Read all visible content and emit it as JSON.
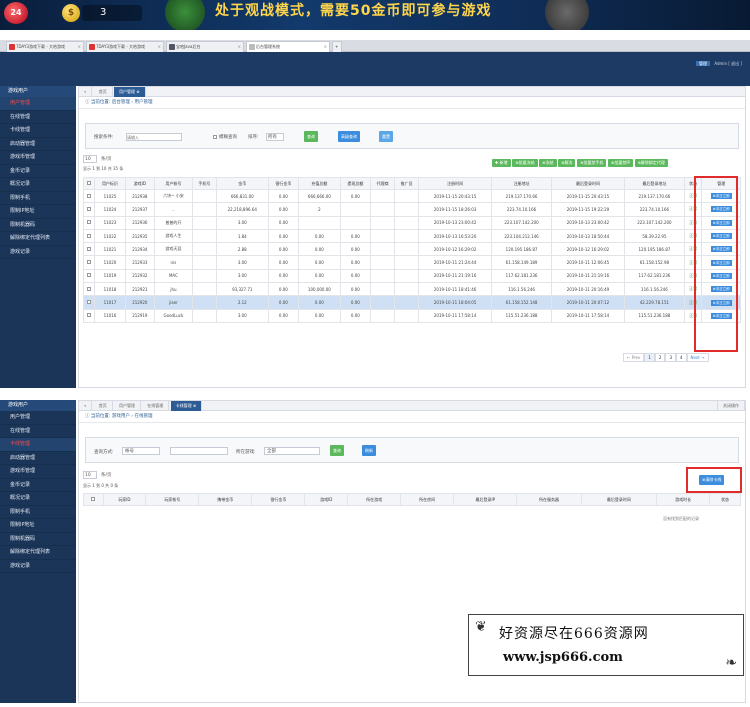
{
  "banner": {
    "logo": "24",
    "coins": "3",
    "message": "处于观战模式，需要50金币即可参与游戏"
  },
  "browser_tabs": [
    {
      "label": "7DAY3游戏下载 - 大哈游戏"
    },
    {
      "label": "7DAY3游戏下载 - 大哈游戏"
    },
    {
      "label": "宝哈Java后台"
    },
    {
      "label": "后台管理系统"
    }
  ],
  "header": {
    "user_role": "管理",
    "user_name": "Admin  [ 退出 ]"
  },
  "sidebar_top": {
    "title": "游戏用户",
    "items": [
      "用户管理",
      "在线管理",
      "卡线管理",
      "启动器管理",
      "游戏币管理",
      "金币记录",
      "概况记录",
      "限制手机",
      "限制IP地址",
      "限制机器码",
      "解除绑定代理列表",
      "游戏记录"
    ]
  },
  "panel1": {
    "tabs": [
      "首页",
      "用户管理 ⊗"
    ],
    "breadcrumb": "ⓘ 当前位置: 后台管理 › 用户管理",
    "search_label": "搜索条件:",
    "search_placeholder": "请输入",
    "exact_label": "模糊查询",
    "by_label": "排序:",
    "select_value": "所有",
    "btn_search": "查询",
    "btn_advanced": "高级查询",
    "btn_reset": "重置",
    "page_size": "10",
    "page_size_suffix": "条/页",
    "records_info": "显示 1 到 10 共 35 条",
    "toolbar": [
      "✚ 新增",
      "⊕批量冻结",
      "⊕冻结",
      "⊕解冻",
      "⊕批量禁手机",
      "⊕批量禁IP",
      "⊕解除绑定代理"
    ],
    "columns": [
      "",
      "用户标识",
      "游戏ID",
      "用户帐号",
      "手机号",
      "金币",
      "银行金币",
      "充值总额",
      "提现总额",
      "代理商",
      "推广员",
      "注册时间",
      "注册地址",
      "最后登录时间",
      "最后登录地址",
      "状态",
      "管理"
    ],
    "rows": [
      [
        "11025",
        "212938",
        "六块~ 小安",
        "",
        "666,831.00",
        "0.00",
        "666,666.00",
        "0.00",
        "",
        "",
        "2019-11-15 20:43:15",
        "219.137.170.66",
        "2019-11-15 20:43:15",
        "219.137.170.66",
        "正常",
        "⊕冲正立即"
      ],
      [
        "11024",
        "212937",
        "..",
        "",
        "22,218,896.64",
        "0.00",
        "2",
        "",
        "",
        "",
        "2019-11-15 18:26:03",
        "223.74.10.166",
        "2019-11-15 19:22:29",
        "223.74.10.166",
        "正常",
        "⊕冲正立即"
      ],
      [
        "11023",
        "212936",
        "普普的开",
        "",
        "3.00",
        "0.00",
        "",
        "",
        "",
        "",
        "2019-10-13 23:00:42",
        "223.107.142.200",
        "2019-10-13 23:00:42",
        "223.107.142.200",
        "正常",
        "⊕冲正立即"
      ],
      [
        "11022",
        "212935",
        "游戏人生",
        "",
        "1.84",
        "0.00",
        "0.00",
        "0.00",
        "",
        "",
        "2019-10-13 16:53:20",
        "223.104.212.146",
        "2019-10-13 18:50:44",
        "58.39.22.95",
        "正常",
        "⊕冲正立即"
      ],
      [
        "11021",
        "212934",
        "游戏天涯",
        "",
        "2.88",
        "0.00",
        "0.00",
        "0.00",
        "",
        "",
        "2019-10-12 16:29:02",
        "120.195.186.87",
        "2019-10-12 16:29:02",
        "120.195.186.87",
        "正常",
        "⊕冲正立即"
      ],
      [
        "11020",
        "212933",
        "nis",
        "",
        "3.00",
        "0.00",
        "0.00",
        "0.00",
        "",
        "",
        "2019-10-11 21:24:44",
        "61.158.149.189",
        "2019-10-11 12:06:45",
        "61.158.152.98",
        "正常",
        "⊕冲正立即"
      ],
      [
        "11019",
        "212932",
        "MAC",
        "",
        "3.00",
        "0.00",
        "0.00",
        "0.00",
        "",
        "",
        "2019-10-11 21:19:16",
        "117.62.181.236",
        "2019-10-11 21:19:16",
        "117.62.181.236",
        "正常",
        "⊕冲正立即"
      ],
      [
        "11018",
        "212921",
        "jhu",
        "",
        "93,327.71",
        "0.00",
        "100,000.00",
        "0.00",
        "",
        "",
        "2019-10-11 18:41:46",
        "116.1.56.246",
        "2019-10-11 20:16:49",
        "116.1.56.246",
        "正常",
        "⊕冲正立即"
      ],
      [
        "11017",
        "212920",
        "jiaer",
        "",
        "2.12",
        "0.00",
        "0.00",
        "0.00",
        "",
        "",
        "2019-10-11 18:04:05",
        "61.158.152.148",
        "2019-10-11 20:07:12",
        "42.229.78.151",
        "正常",
        "⊕冲正立即"
      ],
      [
        "11016",
        "212919",
        "GoodLuck",
        "",
        "3.00",
        "0.00",
        "0.00",
        "0.00",
        "",
        "",
        "2019-10-11 17:58:14",
        "115.51.236.188",
        "2019-10-11 17:58:14",
        "115.51.236.188",
        "正常",
        "⊕冲正立即"
      ]
    ],
    "pager": [
      "← Prev",
      "1",
      "2",
      "3",
      "4",
      "Next →"
    ]
  },
  "sidebar_bottom": {
    "title": "游戏用户",
    "items": [
      "用户管理",
      "在线管理",
      "卡线管理",
      "启动器管理",
      "游戏币管理",
      "金币记录",
      "概况记录",
      "限制手机",
      "限制IP地址",
      "限制机器码",
      "解除绑定代理列表",
      "游戏记录"
    ]
  },
  "panel2": {
    "tabs": [
      "首页",
      "用户管理",
      "在线管理",
      "卡线管理 ⊗"
    ],
    "right_tab": "关闭操作",
    "breadcrumb": "ⓘ 当前位置: 游戏用户 › 在线管理",
    "query_label": "查询方式:",
    "query_select": "帐号",
    "game_label": "所在游戏:",
    "game_select": "全部",
    "btn_search": "查询",
    "btn_reset": "刷新",
    "page_size": "10",
    "page_size_suffix": "条/页",
    "records_info": "显示 1 到 0 共 0 条",
    "btn_clear": "⊕清除卡线",
    "columns": [
      "",
      "玩家ID",
      "玩家帐号",
      "携带金币",
      "银行金币",
      "游戏ID",
      "所在游戏",
      "所在房间",
      "最后登录IP",
      "所在服务器",
      "最后登录时间",
      "游戏时长",
      "状态"
    ],
    "empty_text": "没有找到匹配的记录"
  },
  "watermark": {
    "line1": "好资源尽在666资源网",
    "line2": "www.jsp666.com"
  }
}
